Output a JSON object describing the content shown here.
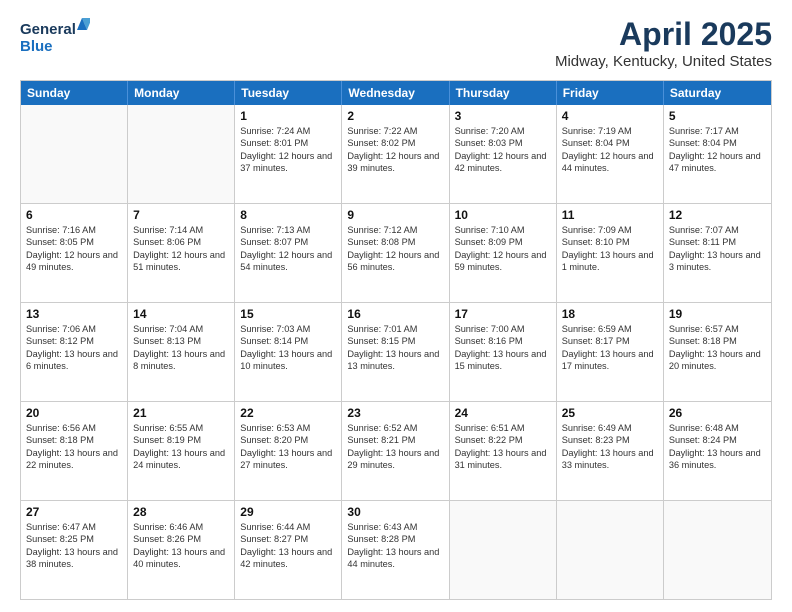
{
  "logo": {
    "line1": "General",
    "line2": "Blue"
  },
  "title": "April 2025",
  "subtitle": "Midway, Kentucky, United States",
  "header_days": [
    "Sunday",
    "Monday",
    "Tuesday",
    "Wednesday",
    "Thursday",
    "Friday",
    "Saturday"
  ],
  "rows": [
    [
      {
        "day": "",
        "info": ""
      },
      {
        "day": "",
        "info": ""
      },
      {
        "day": "1",
        "info": "Sunrise: 7:24 AM\nSunset: 8:01 PM\nDaylight: 12 hours and 37 minutes."
      },
      {
        "day": "2",
        "info": "Sunrise: 7:22 AM\nSunset: 8:02 PM\nDaylight: 12 hours and 39 minutes."
      },
      {
        "day": "3",
        "info": "Sunrise: 7:20 AM\nSunset: 8:03 PM\nDaylight: 12 hours and 42 minutes."
      },
      {
        "day": "4",
        "info": "Sunrise: 7:19 AM\nSunset: 8:04 PM\nDaylight: 12 hours and 44 minutes."
      },
      {
        "day": "5",
        "info": "Sunrise: 7:17 AM\nSunset: 8:04 PM\nDaylight: 12 hours and 47 minutes."
      }
    ],
    [
      {
        "day": "6",
        "info": "Sunrise: 7:16 AM\nSunset: 8:05 PM\nDaylight: 12 hours and 49 minutes."
      },
      {
        "day": "7",
        "info": "Sunrise: 7:14 AM\nSunset: 8:06 PM\nDaylight: 12 hours and 51 minutes."
      },
      {
        "day": "8",
        "info": "Sunrise: 7:13 AM\nSunset: 8:07 PM\nDaylight: 12 hours and 54 minutes."
      },
      {
        "day": "9",
        "info": "Sunrise: 7:12 AM\nSunset: 8:08 PM\nDaylight: 12 hours and 56 minutes."
      },
      {
        "day": "10",
        "info": "Sunrise: 7:10 AM\nSunset: 8:09 PM\nDaylight: 12 hours and 59 minutes."
      },
      {
        "day": "11",
        "info": "Sunrise: 7:09 AM\nSunset: 8:10 PM\nDaylight: 13 hours and 1 minute."
      },
      {
        "day": "12",
        "info": "Sunrise: 7:07 AM\nSunset: 8:11 PM\nDaylight: 13 hours and 3 minutes."
      }
    ],
    [
      {
        "day": "13",
        "info": "Sunrise: 7:06 AM\nSunset: 8:12 PM\nDaylight: 13 hours and 6 minutes."
      },
      {
        "day": "14",
        "info": "Sunrise: 7:04 AM\nSunset: 8:13 PM\nDaylight: 13 hours and 8 minutes."
      },
      {
        "day": "15",
        "info": "Sunrise: 7:03 AM\nSunset: 8:14 PM\nDaylight: 13 hours and 10 minutes."
      },
      {
        "day": "16",
        "info": "Sunrise: 7:01 AM\nSunset: 8:15 PM\nDaylight: 13 hours and 13 minutes."
      },
      {
        "day": "17",
        "info": "Sunrise: 7:00 AM\nSunset: 8:16 PM\nDaylight: 13 hours and 15 minutes."
      },
      {
        "day": "18",
        "info": "Sunrise: 6:59 AM\nSunset: 8:17 PM\nDaylight: 13 hours and 17 minutes."
      },
      {
        "day": "19",
        "info": "Sunrise: 6:57 AM\nSunset: 8:18 PM\nDaylight: 13 hours and 20 minutes."
      }
    ],
    [
      {
        "day": "20",
        "info": "Sunrise: 6:56 AM\nSunset: 8:18 PM\nDaylight: 13 hours and 22 minutes."
      },
      {
        "day": "21",
        "info": "Sunrise: 6:55 AM\nSunset: 8:19 PM\nDaylight: 13 hours and 24 minutes."
      },
      {
        "day": "22",
        "info": "Sunrise: 6:53 AM\nSunset: 8:20 PM\nDaylight: 13 hours and 27 minutes."
      },
      {
        "day": "23",
        "info": "Sunrise: 6:52 AM\nSunset: 8:21 PM\nDaylight: 13 hours and 29 minutes."
      },
      {
        "day": "24",
        "info": "Sunrise: 6:51 AM\nSunset: 8:22 PM\nDaylight: 13 hours and 31 minutes."
      },
      {
        "day": "25",
        "info": "Sunrise: 6:49 AM\nSunset: 8:23 PM\nDaylight: 13 hours and 33 minutes."
      },
      {
        "day": "26",
        "info": "Sunrise: 6:48 AM\nSunset: 8:24 PM\nDaylight: 13 hours and 36 minutes."
      }
    ],
    [
      {
        "day": "27",
        "info": "Sunrise: 6:47 AM\nSunset: 8:25 PM\nDaylight: 13 hours and 38 minutes."
      },
      {
        "day": "28",
        "info": "Sunrise: 6:46 AM\nSunset: 8:26 PM\nDaylight: 13 hours and 40 minutes."
      },
      {
        "day": "29",
        "info": "Sunrise: 6:44 AM\nSunset: 8:27 PM\nDaylight: 13 hours and 42 minutes."
      },
      {
        "day": "30",
        "info": "Sunrise: 6:43 AM\nSunset: 8:28 PM\nDaylight: 13 hours and 44 minutes."
      },
      {
        "day": "",
        "info": ""
      },
      {
        "day": "",
        "info": ""
      },
      {
        "day": "",
        "info": ""
      }
    ]
  ]
}
